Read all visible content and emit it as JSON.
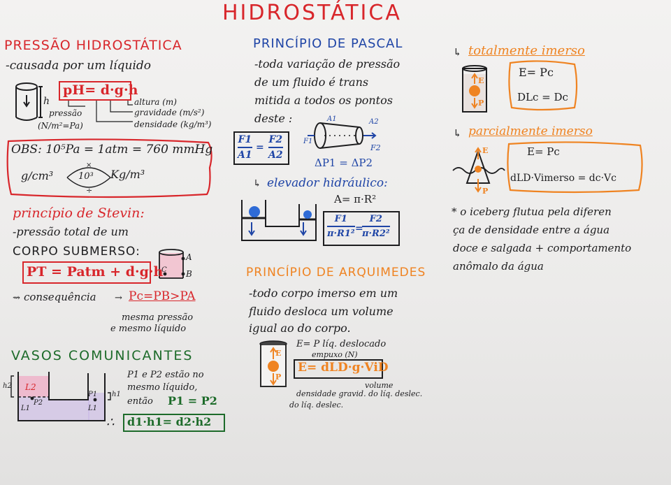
{
  "title": "HIDROSTÁTICA",
  "left": {
    "pressao_title": "PRESSÃO HIDROSTÁTICA",
    "causada": "-causada por um líquido",
    "formula": "pH= d·g·h",
    "h_label": "h",
    "altura": "altura (m)",
    "gravidade": "gravidade (m/s²)",
    "densidade": "densidade (kg/m³)",
    "pressao": "pressão",
    "pressao_units": "(N/m²=Pa)",
    "obs_line": "OBS: 10⁵Pa = 1atm = 760 mmHg",
    "conv_left": "g/cm³",
    "conv_mid": "10³",
    "conv_right": "Kg/m³",
    "stevin_title": "princípio de Stevin:",
    "stevin_1": "-pressão total de um",
    "stevin_2": "CORPO SUBMERSO:",
    "stevin_formula": "PT = Patm + d·g·h",
    "label_a": "A",
    "label_b": "B",
    "label_c": "C",
    "consequencia": "consequência",
    "pc_formula": "Pc=PB>PA",
    "mesma_1": "mesma pressão",
    "mesma_2": "e mesmo líquido",
    "vasos_title": "VASOS COMUNICANTES",
    "vasos_1": "P1 e P2 estão no",
    "vasos_2": "mesmo líquido,",
    "vasos_3": "então",
    "vasos_eq": "P1 = P2",
    "vasos_formula": "d1·h1= d2·h2",
    "therefore": "∴",
    "v_h2": "h2",
    "v_h1": "h1",
    "v_l2": "L2",
    "v_l1a": "L1",
    "v_l1b": "L1",
    "v_p2": "P2",
    "v_p1": "P1"
  },
  "middle": {
    "pascal_title": "PRINCÍPIO DE PASCAL",
    "pascal_1": "-toda variação de pressão",
    "pascal_2": "de um fluido é trans",
    "pascal_3": "mitida a todos os pontos",
    "pascal_4": "deste :",
    "f1_label": "F1",
    "a1_label": "A1",
    "f2_label": "F2",
    "a2_label": "A2",
    "f1": "F1",
    "a1": "A1",
    "f2": "F2",
    "a2": "A2",
    "delta_eq": "ΔP1 = ΔP2",
    "elevador_title": "elevador hidráulico:",
    "area_formula": "A= π·R²",
    "frac_f1": "F1",
    "frac_pr1": "π·R1²",
    "frac_f2": "F2",
    "frac_pr2": "π·R2²",
    "eq_sign": "=",
    "arq_title": "PRINCÍPIO DE ARQUIMEDES",
    "arq_1": "-todo corpo imerso em um",
    "arq_2": "fluido desloca um volume",
    "arq_3": "igual ao do corpo.",
    "e_eq_p": "E= P líq. deslocado",
    "empuxo": "empuxo (N)",
    "arq_formula": "E= dLD·g·ViD",
    "volume": "volume",
    "dens_grav": "densidade gravid. do líq. deslec.",
    "do_liq": "do líq. deslec.",
    "lbl_e": "E",
    "lbl_p": "P"
  },
  "right": {
    "tot_title": "totalmente imerso",
    "tot_1": "E= Pc",
    "tot_2": "DLc = Dc",
    "par_title": "parcialmente imerso",
    "par_1": "E= Pc",
    "par_2": "dLD·Vimerso = dc·Vc",
    "iceberg_1": "* o iceberg flutua pela diferen",
    "iceberg_2": "ça de densidade entre a água",
    "iceberg_3": "doce e salgada + comportamento",
    "iceberg_4": "anômalo da água",
    "lbl_e": "E",
    "lbl_p": "P"
  },
  "colors": {
    "red": "#d8262b",
    "blue": "#1f45a6",
    "green": "#1d6b2a",
    "orange": "#ef8321",
    "highlight_pink": "#f4b6c8",
    "highlight_purple": "#c9b6e8"
  }
}
